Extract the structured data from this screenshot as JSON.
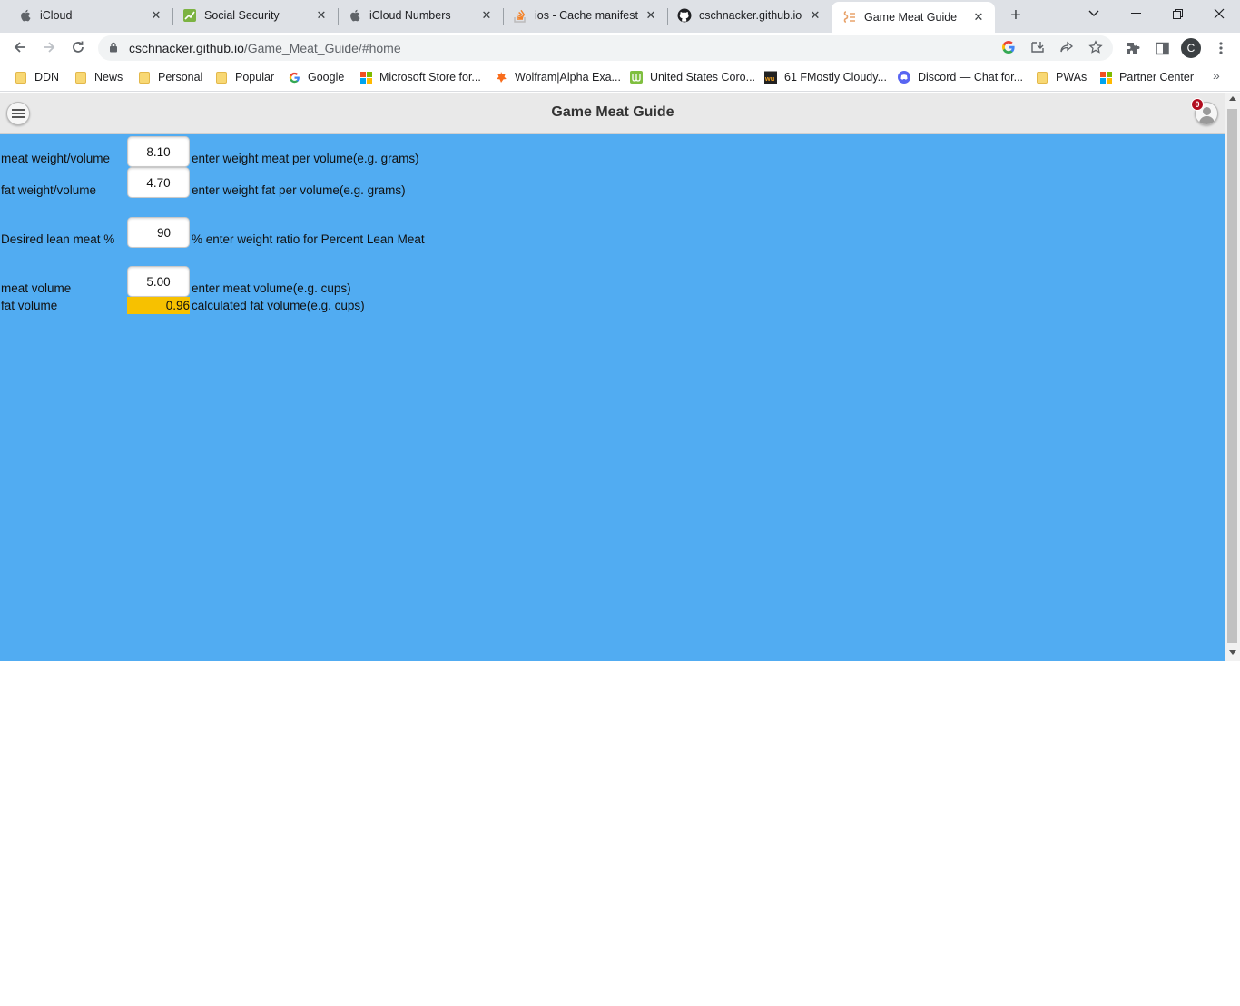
{
  "browser": {
    "tabs": [
      {
        "title": "iCloud",
        "icon": "apple-icon"
      },
      {
        "title": "Social Security",
        "icon": "ssa-icon"
      },
      {
        "title": "iCloud Numbers",
        "icon": "apple-icon"
      },
      {
        "title": "ios - Cache manifest s",
        "icon": "stackoverflow-icon"
      },
      {
        "title": "cschnacker.github.io/G",
        "icon": "github-icon"
      },
      {
        "title": "Game Meat Guide",
        "icon": "page-icon",
        "active": true
      }
    ],
    "address": {
      "host": "cschnacker.github.io",
      "path": "/Game_Meat_Guide/#home"
    },
    "profile_initial": "C",
    "bookmarks": [
      {
        "label": "DDN",
        "icon": "folder-icon"
      },
      {
        "label": "News",
        "icon": "folder-icon"
      },
      {
        "label": "Personal",
        "icon": "folder-icon"
      },
      {
        "label": "Popular",
        "icon": "folder-icon"
      },
      {
        "label": "Google",
        "icon": "google-icon"
      },
      {
        "label": "Microsoft Store for...",
        "icon": "microsoft-icon"
      },
      {
        "label": "Wolfram|Alpha Exa...",
        "icon": "wolfram-icon"
      },
      {
        "label": "United States Coro...",
        "icon": "worldometer-icon"
      },
      {
        "label": "61 FMostly Cloudy...",
        "icon": "wunderground-icon"
      },
      {
        "label": "Discord — Chat for...",
        "icon": "discord-icon"
      },
      {
        "label": "PWAs",
        "icon": "folder-icon"
      },
      {
        "label": "Partner Center",
        "icon": "microsoft-icon"
      }
    ],
    "bookmarks_overflow": "»"
  },
  "app": {
    "title": "Game Meat Guide",
    "notification_count": "0",
    "form": {
      "meat_weight": {
        "label": "meat weight/volume",
        "value": "8.10",
        "hint": "enter weight meat per volume(e.g. grams)"
      },
      "fat_weight": {
        "label": "fat weight/volume",
        "value": "4.70",
        "hint": "enter weight fat per volume(e.g. grams)"
      },
      "lean_pct": {
        "label": "Desired lean meat %",
        "value": "90",
        "hint": "% enter weight ratio for Percent Lean Meat"
      },
      "meat_volume": {
        "label": "meat volume",
        "value": "5.00",
        "hint": "enter meat volume(e.g. cups)"
      },
      "fat_volume": {
        "label": "fat volume",
        "value": "0.96",
        "hint": "calculated fat volume(e.g. cups)"
      }
    }
  },
  "colors": {
    "content_bg": "#51acf2",
    "calculated_bg": "#f7c100",
    "header_bg": "#e9e9e9"
  }
}
